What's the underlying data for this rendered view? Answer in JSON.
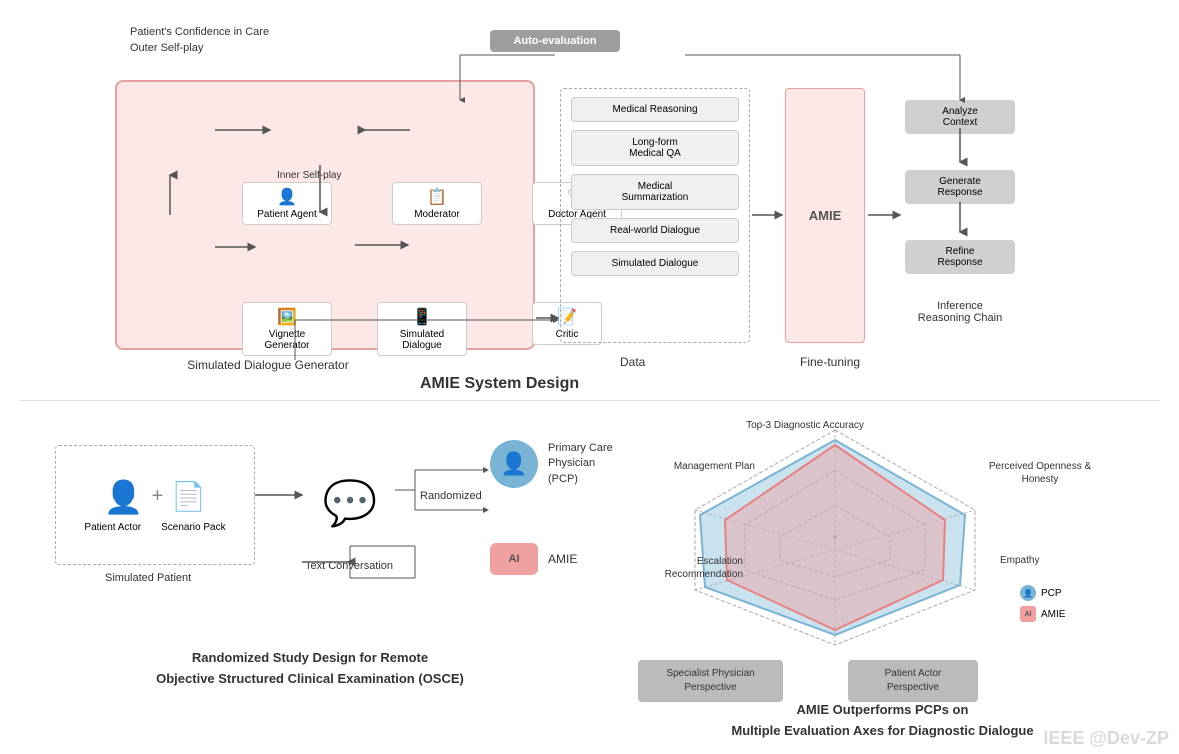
{
  "top": {
    "auto_eval": "Auto-evaluation",
    "outer_selfplay": "Outer Self-play",
    "patients_confidence": "Patient's Confidence in Care",
    "inner_selfplay": "Inner Self-play",
    "agents": {
      "patient_agent": "Patient Agent",
      "moderator": "Moderator",
      "doctor_agent": "Doctor Agent",
      "vignette_generator": "Vignette Generator",
      "simulated_dialogue": "Simulated Dialogue",
      "critic": "Critic"
    },
    "data_items": [
      "Medical Reasoning",
      "Long-form Medical QA",
      "Medical Summarization",
      "Real-world Dialogue",
      "Simulated Dialogue"
    ],
    "data_label": "Data",
    "fine_tuning_label": "Fine-tuning",
    "amie_label": "AMIE",
    "inference_boxes": [
      "Analyze Context",
      "Generate Response",
      "Refine Response"
    ],
    "inference_label": "Inference Reasoning Chain",
    "sdg_label": "Simulated Dialogue Generator",
    "system_design_title": "AMIE System Design"
  },
  "bottom_left": {
    "simulated_patient_label": "Simulated Patient",
    "patient_actor_label": "Patient Actor",
    "scenario_pack_label": "Scenario Pack",
    "randomized_label": "Randomized",
    "text_conv_label": "Text Conversation",
    "pcp_label": "Primary Care Physician (PCP)",
    "amie_label": "AMIE",
    "osce_title_line1": "Randomized Study Design for Remote",
    "osce_title_line2": "Objective Structured Clinical Examination (OSCE)"
  },
  "bottom_right": {
    "radar_labels": {
      "top": "Top-3 Diagnostic Accuracy",
      "top_right": "Perceived Openness & Honesty",
      "right": "Empathy",
      "bottom_right": "Patient Actor Perspective",
      "bottom_left": "Specialist Physician Perspective",
      "left": "Escalation Recommendation",
      "top_left": "Management Plan"
    },
    "legend": {
      "pcp_label": "PCP",
      "amie_label": "AMIE"
    },
    "specialist_btn": "Specialist Physician Perspective",
    "patient_actor_btn": "Patient Actor Perspective",
    "radar_title_line1": "AMIE Outperforms PCPs on",
    "radar_title_line2": "Multiple Evaluation Axes for Diagnostic Dialogue"
  },
  "watermark": "IEEE @Dev-ZP"
}
